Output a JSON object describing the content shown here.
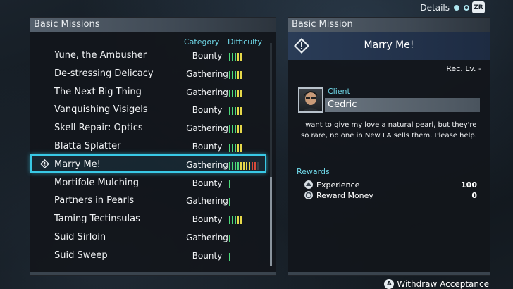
{
  "top": {
    "details_label": "Details",
    "zr_label": "ZR"
  },
  "left_panel": {
    "title": "Basic Missions",
    "col_category": "Category",
    "col_difficulty": "Difficulty",
    "missions": [
      {
        "name": "Yune, the Ambusher",
        "category": "Bounty",
        "difficulty": 5
      },
      {
        "name": "De-stressing Delicacy",
        "category": "Gathering",
        "difficulty": 5
      },
      {
        "name": "The Next Big Thing",
        "category": "Gathering",
        "difficulty": 5
      },
      {
        "name": "Vanquishing Visigels",
        "category": "Bounty",
        "difficulty": 5
      },
      {
        "name": "Skell Repair: Optics",
        "category": "Gathering",
        "difficulty": 5
      },
      {
        "name": "Blatta Splatter",
        "category": "Bounty",
        "difficulty": 5
      },
      {
        "name": "Marry Me!",
        "category": "Gathering",
        "difficulty": 10
      },
      {
        "name": "Mortifole Mulching",
        "category": "Bounty",
        "difficulty": 1
      },
      {
        "name": "Partners in Pearls",
        "category": "Gathering",
        "difficulty": 1
      },
      {
        "name": "Taming Tectinsulas",
        "category": "Bounty",
        "difficulty": 5
      },
      {
        "name": "Suid Sirloin",
        "category": "Gathering",
        "difficulty": 1
      },
      {
        "name": "Suid Sweep",
        "category": "Bounty",
        "difficulty": 1
      }
    ],
    "selected_index": 6
  },
  "right_panel": {
    "title": "Basic Mission",
    "mission_title": "Marry Me!",
    "rec_lv": "Rec. Lv. -",
    "client_label": "Client",
    "client_name": "Cedric",
    "description": "I want to give my love a natural pearl, but they're so rare, no one in New LA sells them. Please help.",
    "rewards_label": "Rewards",
    "rewards": [
      {
        "label": "Experience",
        "value": "100",
        "icon": "experience-icon"
      },
      {
        "label": "Reward Money",
        "value": "0",
        "icon": "coin-icon"
      }
    ]
  },
  "footer": {
    "button": "A",
    "label": "Withdraw Acceptance"
  },
  "colors": {
    "accent": "#39c9e6",
    "header_text": "#6fd8e8",
    "diff_green": "#4cd97a",
    "diff_yellow": "#e6d84a",
    "diff_red": "#d84a3a"
  }
}
